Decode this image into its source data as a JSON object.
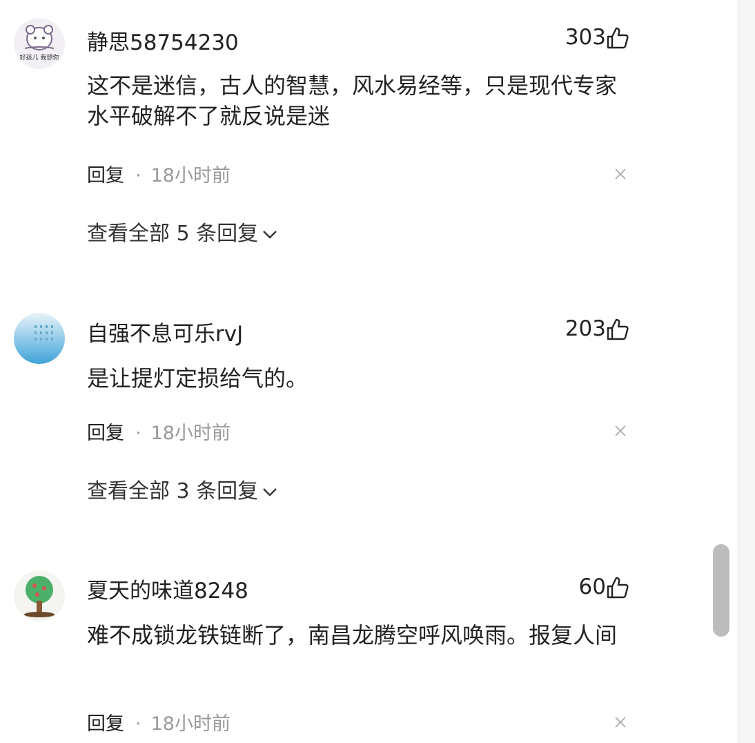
{
  "comments": [
    {
      "username": "静思58754230",
      "likes": "303",
      "content": "这不是迷信，古人的智慧，风水易经等，只是现代专家水平破解不了就反说是迷",
      "reply_label": "回复",
      "separator": "·",
      "time": "18小时前",
      "expand": "查看全部 5 条回复",
      "avatar": {
        "icon": "bear-cartoon-avatar",
        "caption": "好孩儿 我想你"
      }
    },
    {
      "username": "自强不息可乐rvJ",
      "likes": "203",
      "content": "是让提灯定损给气的。",
      "reply_label": "回复",
      "separator": "·",
      "time": "18小时前",
      "expand": "查看全部 3 条回复",
      "avatar": {
        "icon": "blue-sky-avatar"
      }
    },
    {
      "username": "夏天的味道8248",
      "likes": "60",
      "content": "难不成锁龙铁链断了，南昌龙腾空呼风唤雨。报复人间",
      "reply_label": "回复",
      "separator": "·",
      "time": "18小时前",
      "avatar": {
        "icon": "tree-avatar"
      }
    }
  ],
  "colors": {
    "text": "#222222",
    "muted": "#999999",
    "scrollbar": "#bcbcbc"
  }
}
